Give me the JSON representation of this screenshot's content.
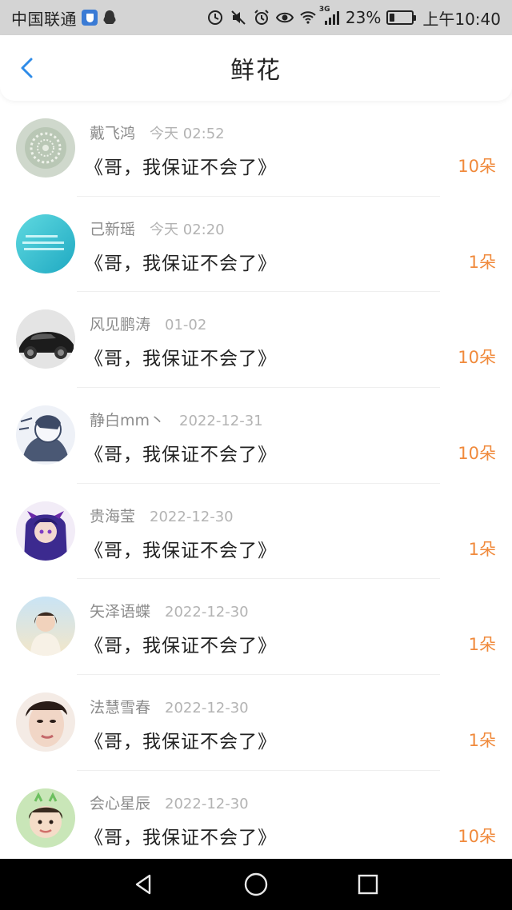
{
  "status_bar": {
    "carrier": "中国联通",
    "battery_pct": "23%",
    "battery_level": 0.23,
    "time": "上午10:40",
    "signal_label": "3G"
  },
  "header": {
    "title": "鲜花"
  },
  "gifts": [
    {
      "name": "戴飞鸿",
      "time": "今天 02:52",
      "gift": "《哥，我保证不会了》",
      "count": "10朵",
      "avatar": "lace-avatar"
    },
    {
      "name": "己新瑶",
      "time": "今天 02:20",
      "gift": "《哥，我保证不会了》",
      "count": "1朵",
      "avatar": "teal-text-avatar"
    },
    {
      "name": "风见鹏涛",
      "time": "01-02",
      "gift": "《哥，我保证不会了》",
      "count": "10朵",
      "avatar": "car-avatar"
    },
    {
      "name": "静白mm丶",
      "time": "2022-12-31",
      "gift": "《哥，我保证不会了》",
      "count": "10朵",
      "avatar": "sketch-avatar"
    },
    {
      "name": "贵海莹",
      "time": "2022-12-30",
      "gift": "《哥，我保证不会了》",
      "count": "1朵",
      "avatar": "anime-avatar"
    },
    {
      "name": "矢泽语蝶",
      "time": "2022-12-30",
      "gift": "《哥，我保证不会了》",
      "count": "1朵",
      "avatar": "girl-photo-avatar"
    },
    {
      "name": "法慧雪春",
      "time": "2022-12-30",
      "gift": "《哥，我保证不会了》",
      "count": "1朵",
      "avatar": "face-photo-avatar"
    },
    {
      "name": "会心星辰",
      "time": "2022-12-30",
      "gift": "《哥，我保证不会了》",
      "count": "10朵",
      "avatar": "child-photo-avatar"
    }
  ],
  "colors": {
    "accent_count": "#f08a3c",
    "back_arrow": "#2f8ce8",
    "status_bar_bg": "#d4d4d4"
  }
}
